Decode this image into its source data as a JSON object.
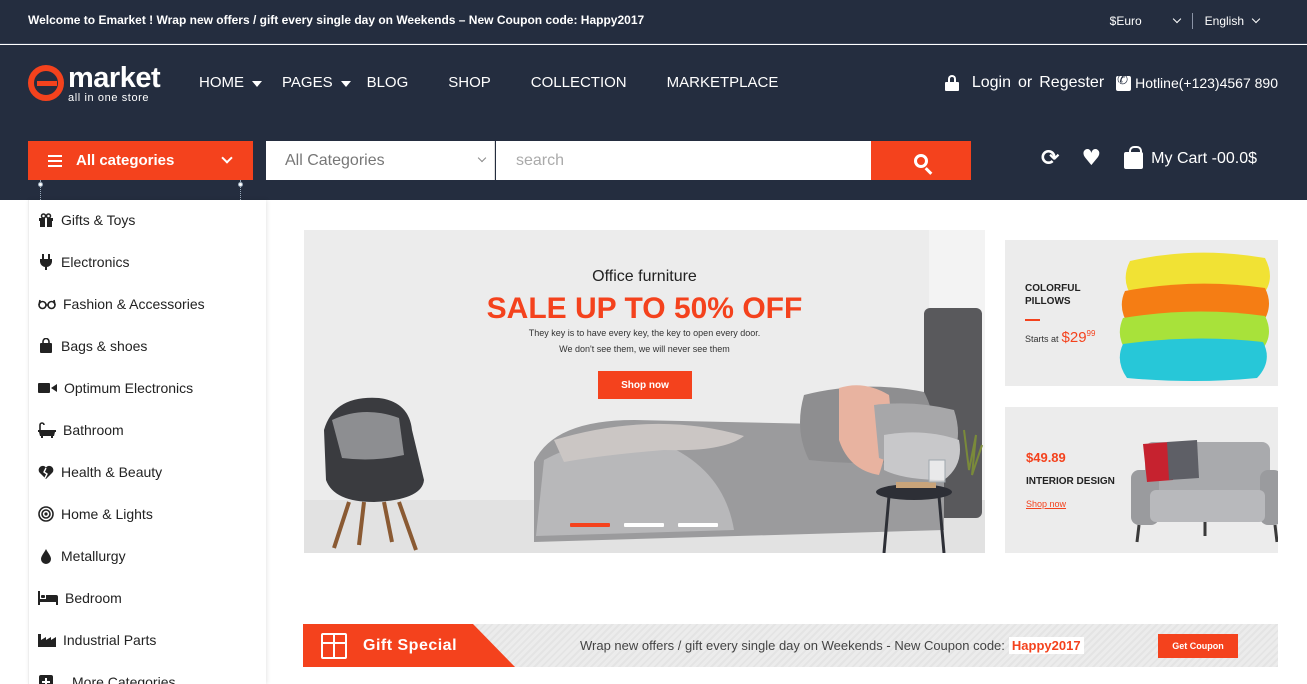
{
  "topbar": {
    "welcome_brand": "Welcome to Emarket !",
    "welcome_text": " Wrap new offers / gift every single day on Weekends – New Coupon code: Happy2017",
    "currency": "$Euro",
    "language": "English"
  },
  "header": {
    "logo_name": "market",
    "logo_tagline": "all in one store",
    "nav": [
      "HOME",
      "PAGES",
      "BLOG",
      "SHOP",
      "COLLECTION",
      "MARKETPLACE"
    ],
    "login": "Login",
    "or": "or",
    "register": "Regester",
    "hotline": "Hotline(+123)4567 890"
  },
  "search": {
    "all_categories_button": "All categories",
    "category_select": "All Categories",
    "placeholder": "search",
    "cart": "My Cart -00.0$"
  },
  "sidebar": {
    "items": [
      {
        "label": "Gifts & Toys",
        "icon": "gift-icon"
      },
      {
        "label": "Electronics",
        "icon": "plug-icon"
      },
      {
        "label": "Fashion & Accessories",
        "icon": "glasses-icon"
      },
      {
        "label": "Bags & shoes",
        "icon": "bag-icon"
      },
      {
        "label": "Optimum Electronics",
        "icon": "video-icon"
      },
      {
        "label": "Bathroom",
        "icon": "bathtub-icon"
      },
      {
        "label": "Health & Beauty",
        "icon": "heart-icon"
      },
      {
        "label": "Home & Lights",
        "icon": "target-icon"
      },
      {
        "label": "Metallurgy",
        "icon": "drop-icon"
      },
      {
        "label": "Bedroom",
        "icon": "bed-icon"
      },
      {
        "label": "Industrial Parts",
        "icon": "factory-icon"
      },
      {
        "label": "More Categories",
        "icon": "plus-icon"
      }
    ]
  },
  "banner": {
    "subtitle": "Office furniture",
    "headline": "SALE UP TO 50% OFF",
    "line1": "They key is to have every key, the key to open every door.",
    "line2": "We don't see them, we will never see them",
    "button": "Shop now",
    "slides_total": 3,
    "active_slide": 1
  },
  "promo_pillows": {
    "title_line1": "COLORFUL",
    "title_line2": "PILLOWS",
    "starts_at": "Starts at",
    "price_main": "$29",
    "price_cents": "99"
  },
  "promo_interior": {
    "price": "$49.89",
    "title": "INTERIOR DESIGN",
    "link": "Shop now"
  },
  "gift": {
    "title": "Gift Special",
    "message": "Wrap new offers / gift every single day on Weekends - New Coupon code:",
    "code": "Happy2017",
    "button": "Get Coupon"
  },
  "colors": {
    "accent": "#f4421d",
    "header_bg": "#242d3f"
  }
}
